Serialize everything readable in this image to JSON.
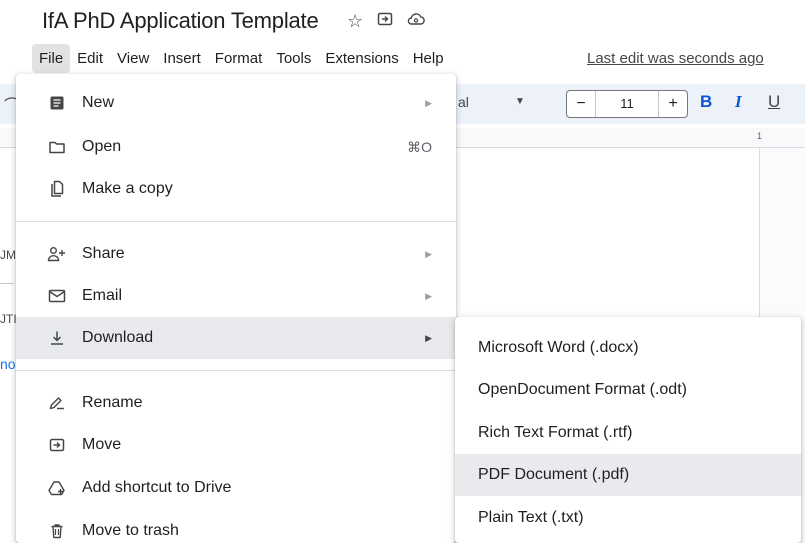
{
  "document": {
    "title": "IfA PhD Application Template",
    "last_edit": "Last edit was seconds ago"
  },
  "title_icons": [
    "star-icon",
    "move-icon",
    "cloud-status-icon"
  ],
  "menubar": {
    "items": [
      "File",
      "Edit",
      "View",
      "Insert",
      "Format",
      "Tools",
      "Extensions",
      "Help"
    ],
    "active": "File"
  },
  "toolbar": {
    "font_fragment": "al",
    "font_size": "11",
    "decrease": "−",
    "increase": "+",
    "bold": "B",
    "italic": "I",
    "underline": "U"
  },
  "ruler": {
    "mark": "1"
  },
  "doc_fragments": {
    "f1": "JM",
    "f2": "JTI",
    "f3": "no"
  },
  "file_menu": {
    "items": [
      {
        "label": "New",
        "icon": "document-icon",
        "submenu": true
      },
      {
        "label": "Open",
        "icon": "folder-icon",
        "shortcut": "⌘O"
      },
      {
        "label": "Make a copy",
        "icon": "copy-icon"
      },
      {
        "label": "Share",
        "icon": "share-person-icon",
        "submenu": true
      },
      {
        "label": "Email",
        "icon": "email-icon",
        "submenu": true
      },
      {
        "label": "Download",
        "icon": "download-icon",
        "submenu": true,
        "highlighted": true
      },
      {
        "label": "Rename",
        "icon": "rename-pencil-icon"
      },
      {
        "label": "Move",
        "icon": "move-folder-icon"
      },
      {
        "label": "Add shortcut to Drive",
        "icon": "drive-shortcut-icon"
      },
      {
        "label": "Move to trash",
        "icon": "trash-icon"
      }
    ]
  },
  "download_submenu": {
    "items": [
      {
        "label": "Microsoft Word (.docx)"
      },
      {
        "label": "OpenDocument Format (.odt)"
      },
      {
        "label": "Rich Text Format (.rtf)"
      },
      {
        "label": "PDF Document (.pdf)",
        "highlighted": true
      },
      {
        "label": "Plain Text (.txt)"
      }
    ]
  },
  "colors": {
    "accent": "#0b57d0",
    "menu_hover": "#e8eaed",
    "toolbar_bg": "#edf2fa"
  }
}
